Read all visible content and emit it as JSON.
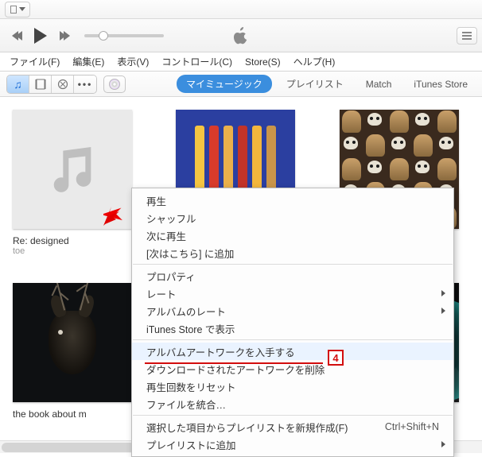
{
  "menubar": {
    "file": "ファイル(F)",
    "edit": "編集(E)",
    "view": "表示(V)",
    "control": "コントロール(C)",
    "store": "Store(S)",
    "help": "ヘルプ(H)"
  },
  "tabs": {
    "my_music": "マイミュージック",
    "playlists": "プレイリスト",
    "match": "Match",
    "itunes_store": "iTunes Store"
  },
  "albums": {
    "a1": {
      "title": "Re: designed",
      "artist": "toe"
    },
    "a2": {
      "title": "",
      "artist": ""
    },
    "a3": {
      "title": "",
      "artist": ""
    },
    "a4": {
      "title": "the book about m",
      "artist": ""
    },
    "a5": {
      "title": "",
      "artist": ""
    },
    "a6": {
      "title": "",
      "artist": ""
    }
  },
  "context_menu": {
    "play": "再生",
    "shuffle": "シャッフル",
    "play_next": "次に再生",
    "add_to_upnext": "[次はこちら] に追加",
    "properties": "プロパティ",
    "rating": "レート",
    "album_rating": "アルバムのレート",
    "show_in_store": "iTunes Store で表示",
    "get_album_artwork": "アルバムアートワークを入手する",
    "delete_downloaded_artwork": "ダウンロードされたアートワークを削除",
    "reset_play_count": "再生回数をリセット",
    "consolidate_files": "ファイルを統合…",
    "new_playlist_from_selection": "選択した項目からプレイリストを新規作成(F)",
    "new_playlist_shortcut": "Ctrl+Shift+N",
    "add_to_playlist": "プレイリストに追加"
  },
  "annotation": {
    "number": "4"
  }
}
